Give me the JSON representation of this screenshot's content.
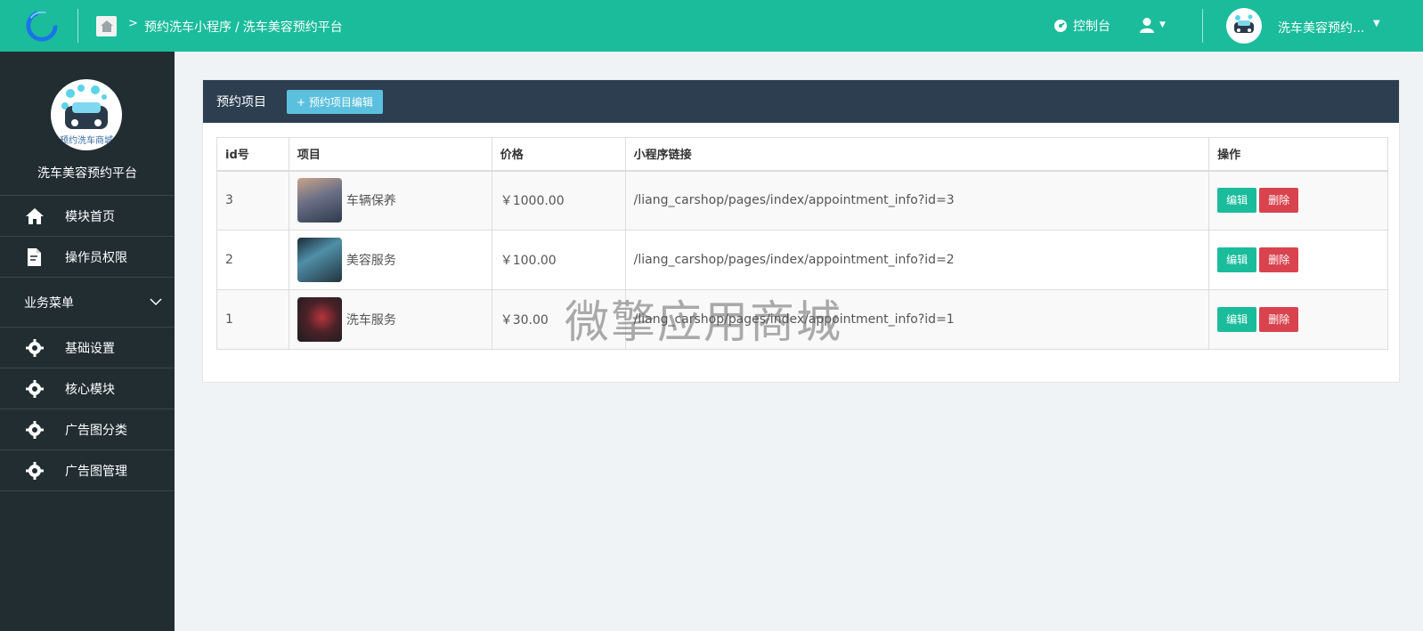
{
  "header": {
    "breadcrumb_app": "预约洗车小程序",
    "breadcrumb_slash": "/",
    "breadcrumb_page": "洗车美容预约平台",
    "console_label": "控制台",
    "username": "洗车美容预约...",
    "accent_color": "#1abc9c"
  },
  "sidebar": {
    "title": "洗车美容预约平台",
    "avatar_caption": "预约洗车商城",
    "items": [
      {
        "label": "模块首页",
        "icon": "home-icon"
      },
      {
        "label": "操作员权限",
        "icon": "document-edit-icon"
      }
    ],
    "group_label": "业务菜单",
    "group_items": [
      {
        "label": "基础设置",
        "icon": "gear-icon"
      },
      {
        "label": "核心模块",
        "icon": "gear-icon"
      },
      {
        "label": "广告图分类",
        "icon": "gear-icon"
      },
      {
        "label": "广告图管理",
        "icon": "gear-icon"
      }
    ]
  },
  "panel": {
    "title": "预约项目",
    "edit_button": "+ 预约项目编辑",
    "columns": [
      "id号",
      "项目",
      "价格",
      "小程序链接",
      "操作"
    ],
    "rows": [
      {
        "id": "3",
        "name": "车辆保养",
        "price": "￥1000.00",
        "link": "/liang_carshop/pages/index/appointment_info?id=3"
      },
      {
        "id": "2",
        "name": "美容服务",
        "price": "￥100.00",
        "link": "/liang_carshop/pages/index/appointment_info?id=2"
      },
      {
        "id": "1",
        "name": "洗车服务",
        "price": "￥30.00",
        "link": "/liang_carshop/pages/index/appointment_info?id=1"
      }
    ],
    "edit_label": "编辑",
    "delete_label": "删除"
  },
  "watermark": "微擎应用商城"
}
